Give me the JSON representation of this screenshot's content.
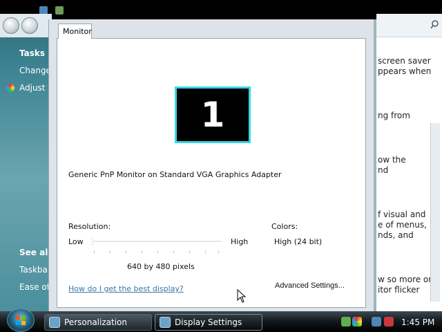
{
  "dialog": {
    "tab_label": "Monitor",
    "monitor_number": "1",
    "monitor_description": "Generic PnP Monitor on Standard VGA Graphics Adapter",
    "resolution_label": "Resolution:",
    "low_label": "Low",
    "high_label": "High",
    "resolution_value": "640 by 480 pixels",
    "resolution_slider_fraction": 0,
    "colors_label": "Colors:",
    "colors_value": "High (24 bit)",
    "help_link": "How do I get the best display?",
    "advanced_button": "Advanced Settings..."
  },
  "background_window": {
    "left_items": [
      {
        "text": "Tasks"
      },
      {
        "text": "Change"
      },
      {
        "text": "Adjust f"
      },
      {
        "text": "See also"
      },
      {
        "text": "Taskbar"
      },
      {
        "text": "Ease of"
      }
    ],
    "right_lines": [
      "screen saver",
      "ppears when",
      "ng from",
      "ow the",
      "nd",
      "f visual and",
      "e of menus,",
      "nds, and",
      "w so more or",
      "itor flicker"
    ],
    "search_icon": "search-icon"
  },
  "taskbar": {
    "items": [
      {
        "label": "Personalization"
      },
      {
        "label": "Display Settings"
      }
    ],
    "clock": "1:45 PM"
  },
  "colors": {
    "monitor_border": "#38d6e6",
    "link": "#3a76a3"
  }
}
